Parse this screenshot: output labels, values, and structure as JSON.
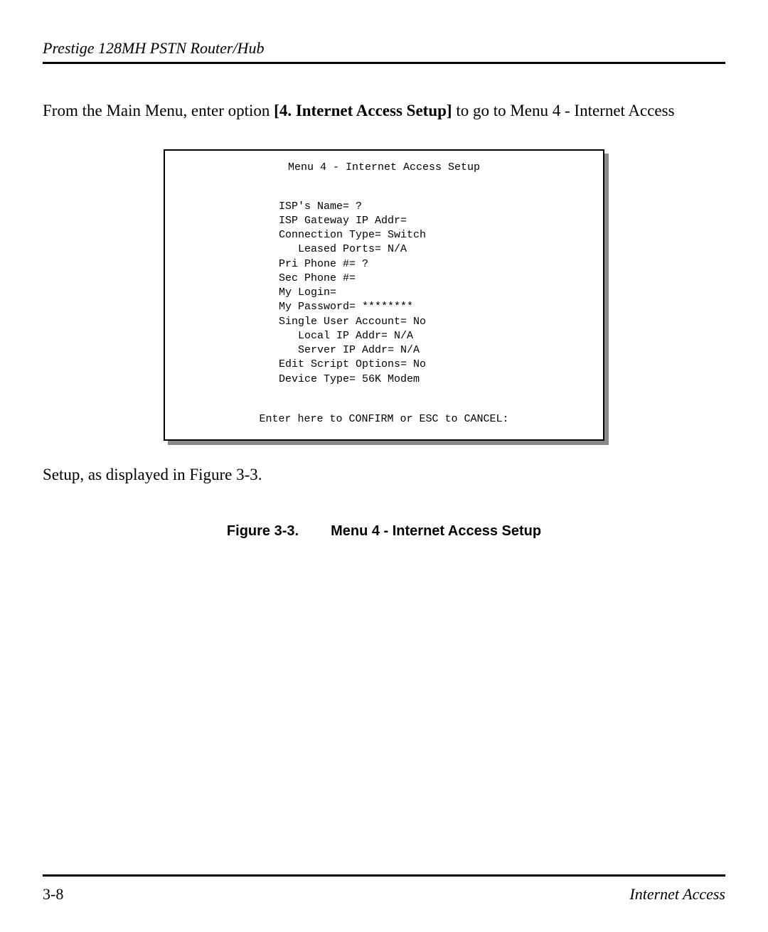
{
  "header": {
    "title": "Prestige 128MH  PSTN Router/Hub"
  },
  "intro": {
    "prefix": "From the Main Menu, enter option ",
    "bold": "[4. Internet Access Setup]",
    "suffix": " to go to Menu 4 - Internet Access"
  },
  "menu": {
    "title": "Menu 4 - Internet Access Setup",
    "lines": [
      "ISP's Name= ?",
      "ISP Gateway IP Addr=",
      "Connection Type= Switch",
      "   Leased Ports= N/A",
      "Pri Phone #= ?",
      "Sec Phone #=",
      "My Login=",
      "My Password= ********",
      "Single User Account= No",
      "   Local IP Addr= N/A",
      "   Server IP Addr= N/A",
      "Edit Script Options= No",
      "Device Type= 56K Modem"
    ],
    "footer": "Enter here to CONFIRM or ESC to CANCEL:"
  },
  "after_text": "Setup, as displayed in Figure 3-3.",
  "figure": {
    "number": "Figure 3-3.",
    "caption": "Menu 4 - Internet Access Setup"
  },
  "footer": {
    "page": "3-8",
    "section": "Internet Access"
  }
}
